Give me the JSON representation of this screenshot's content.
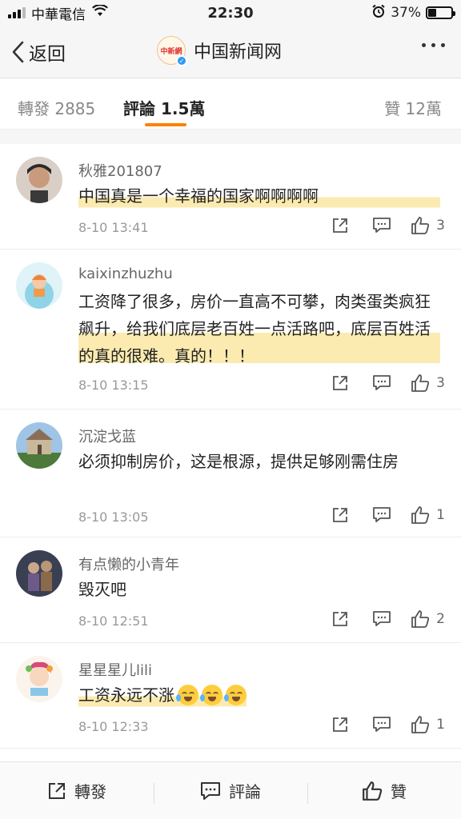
{
  "status_bar": {
    "carrier": "中華電信",
    "time": "22:30",
    "battery": "37%",
    "battery_level": 0.37
  },
  "nav": {
    "back_label": "返回",
    "logo_text": "中新網",
    "title": "中国新闻网"
  },
  "tabs": {
    "repost": "轉發 2885",
    "comments": "評論 1.5萬",
    "likes": "贊 12萬"
  },
  "comments": [
    {
      "name": "秋雅201807",
      "text": "中国真是一个幸福的国家啊啊啊啊",
      "time": "8-10 13:41",
      "likes": "3"
    },
    {
      "name": "kaixinzhuzhu",
      "text": "工资降了很多，房价一直高不可攀，肉类蛋类疯狂飙升，给我们底层老百姓一点活路吧，底层百姓活的真的很难。真的！！！",
      "time": "8-10 13:15",
      "likes": "3"
    },
    {
      "name": "沉淀戈蓝",
      "text": "必须抑制房价，这是根源，提供足够刚需住房",
      "time": "8-10 13:05",
      "likes": "1"
    },
    {
      "name": "有点懒的小青年",
      "text": "毁灭吧",
      "time": "8-10 12:51",
      "likes": "2"
    },
    {
      "name": "星星星儿lili",
      "text": "工资永远不涨",
      "time": "8-10 12:33",
      "likes": "1"
    }
  ],
  "bottom_bar": {
    "repost": "轉發",
    "comment": "評論",
    "like": "贊"
  },
  "colors": {
    "accent": "#ff8200",
    "highlight": "#fae496",
    "verified": "#2d9bf0"
  }
}
